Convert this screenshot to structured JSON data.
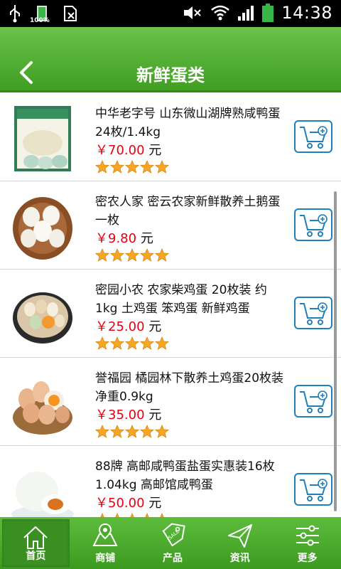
{
  "status_bar": {
    "battery_label": "100%",
    "time": "14:38",
    "icons": [
      "usb-icon",
      "battery-icon",
      "sim-icon",
      "mute-icon",
      "wifi-icon",
      "signal-icon",
      "battery-full-icon"
    ]
  },
  "header": {
    "title": "新鲜蛋类",
    "back_icon": "back-arrow-icon"
  },
  "products": [
    {
      "name": "中华老字号 山东微山湖牌熟咸鸭蛋24枚/1.4kg",
      "price_symbol": "￥",
      "price": "70.00",
      "unit": "元",
      "rating": 5
    },
    {
      "name": "密农人家 密云农家新鲜散养土鹅蛋 一枚",
      "price_symbol": "￥",
      "price": "9.80",
      "unit": "元",
      "rating": 5
    },
    {
      "name": "密园小农 农家柴鸡蛋 20枚装 约1kg 土鸡蛋 笨鸡蛋 新鲜鸡蛋",
      "price_symbol": "￥",
      "price": "25.00",
      "unit": "元",
      "rating": 5
    },
    {
      "name": "誉福园 橘园林下散养土鸡蛋20枚装 净重0.9kg",
      "price_symbol": "￥",
      "price": "35.00",
      "unit": "元",
      "rating": 5
    },
    {
      "name": "88牌 高邮咸鸭蛋盐蛋实惠装16枚 1.04kg 高邮馆咸鸭蛋",
      "price_symbol": "￥",
      "price": "50.00",
      "unit": "元",
      "rating": 5
    }
  ],
  "bottom_nav": [
    {
      "label": "首页",
      "icon": "home-icon",
      "active": true
    },
    {
      "label": "商铺",
      "icon": "map-shop-icon",
      "active": false
    },
    {
      "label": "产品",
      "icon": "sale-tag-icon",
      "active": false
    },
    {
      "label": "资讯",
      "icon": "paper-plane-icon",
      "active": false
    },
    {
      "label": "更多",
      "icon": "sliders-icon",
      "active": false
    }
  ],
  "colors": {
    "header_green": "#4fab2e",
    "price_red": "#e60012",
    "star_orange": "#f5a623",
    "cart_blue": "#1f7fb8"
  }
}
